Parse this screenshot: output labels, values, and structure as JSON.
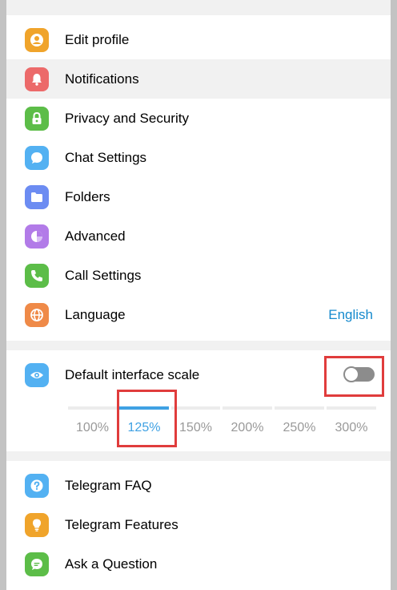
{
  "menu": [
    {
      "label": "Edit profile",
      "icon": "user-circle-icon",
      "color": "#f0a42b"
    },
    {
      "label": "Notifications",
      "icon": "bell-icon",
      "color": "#ec6a6a"
    },
    {
      "label": "Privacy and Security",
      "icon": "lock-icon",
      "color": "#5cbd48"
    },
    {
      "label": "Chat Settings",
      "icon": "chat-bubble-icon",
      "color": "#53b1f2"
    },
    {
      "label": "Folders",
      "icon": "folder-icon",
      "color": "#6c8cf2"
    },
    {
      "label": "Advanced",
      "icon": "pie-chart-icon",
      "color": "#b27be8"
    },
    {
      "label": "Call Settings",
      "icon": "phone-icon",
      "color": "#5cbd48"
    },
    {
      "label": "Language",
      "icon": "globe-icon",
      "color": "#ef8a48",
      "value": "English"
    }
  ],
  "scale": {
    "label": "Default interface scale",
    "icon": "eye-icon",
    "color": "#53b1f2",
    "toggle_on": false,
    "options": [
      "100%",
      "125%",
      "150%",
      "200%",
      "250%",
      "300%"
    ],
    "selected": "125%"
  },
  "help": [
    {
      "label": "Telegram FAQ",
      "icon": "question-icon",
      "color": "#53b1f2"
    },
    {
      "label": "Telegram Features",
      "icon": "lightbulb-icon",
      "color": "#f0a42b"
    },
    {
      "label": "Ask a Question",
      "icon": "chat-dots-icon",
      "color": "#5cbd48"
    }
  ],
  "colors": {
    "accent": "#168acd",
    "highlight_box": "#e03c3c"
  }
}
